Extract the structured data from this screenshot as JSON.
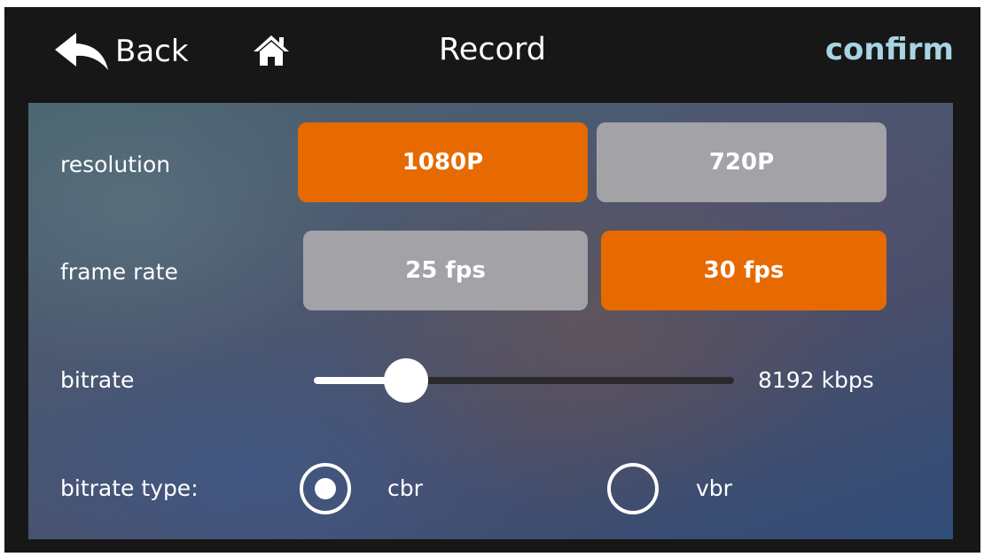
{
  "header": {
    "back_label": "Back",
    "title": "Record",
    "confirm_label": "confirm"
  },
  "settings": {
    "resolution": {
      "label": "resolution",
      "options": [
        "1080P",
        "720P"
      ],
      "selected": "1080P"
    },
    "frame_rate": {
      "label": "frame rate",
      "options": [
        "25 fps",
        "30 fps"
      ],
      "selected": "30 fps"
    },
    "bitrate": {
      "label": "bitrate",
      "value_text": "8192 kbps",
      "slider_fraction": 0.22
    },
    "bitrate_type": {
      "label": "bitrate type:",
      "options": [
        "cbr",
        "vbr"
      ],
      "selected": "cbr"
    }
  },
  "colors": {
    "accent": "#e66a00",
    "unselected": "#a3a2a6",
    "confirm": "#a8d4e2"
  },
  "icons": {
    "back": "back-arrow-icon",
    "home": "home-icon"
  }
}
